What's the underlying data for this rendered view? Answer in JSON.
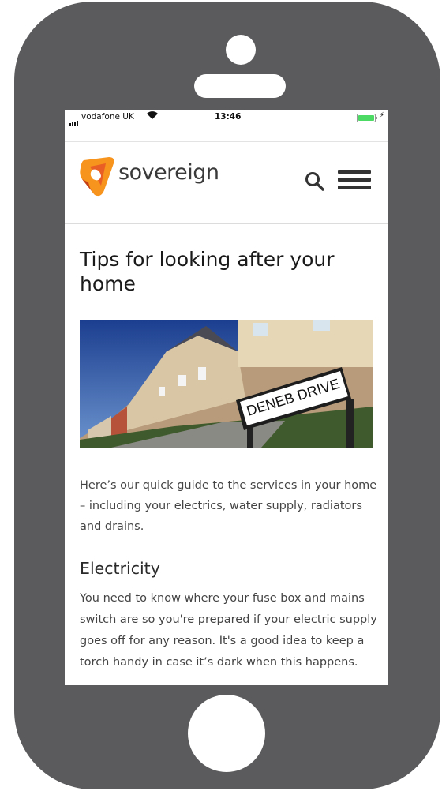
{
  "status_bar": {
    "carrier": "vodafone UK",
    "time": "13:46",
    "battery_level": 1.0
  },
  "header": {
    "brand_name": "sovereign",
    "logo_colors": [
      "#f7941d",
      "#e95e24",
      "#c43e16"
    ],
    "search_icon": "search-icon",
    "menu_icon": "hamburger-menu-icon"
  },
  "article": {
    "title": "Tips for looking after your home",
    "hero_sign_text": "DENEB DRIVE",
    "intro": "Here’s our quick guide to the services in your home – including your electrics, water supply, radiators and drains.",
    "sections": [
      {
        "heading": "Electricity",
        "body": "You need to know where your fuse box and mains switch are so you're prepared if your electric supply goes off for any reason. It's a good idea to keep a torch handy in case it’s dark when this happens."
      }
    ]
  },
  "colors": {
    "device_frame": "#5b5b5d",
    "accent_orange": "#f08a1c",
    "battery_green": "#4cd964"
  }
}
